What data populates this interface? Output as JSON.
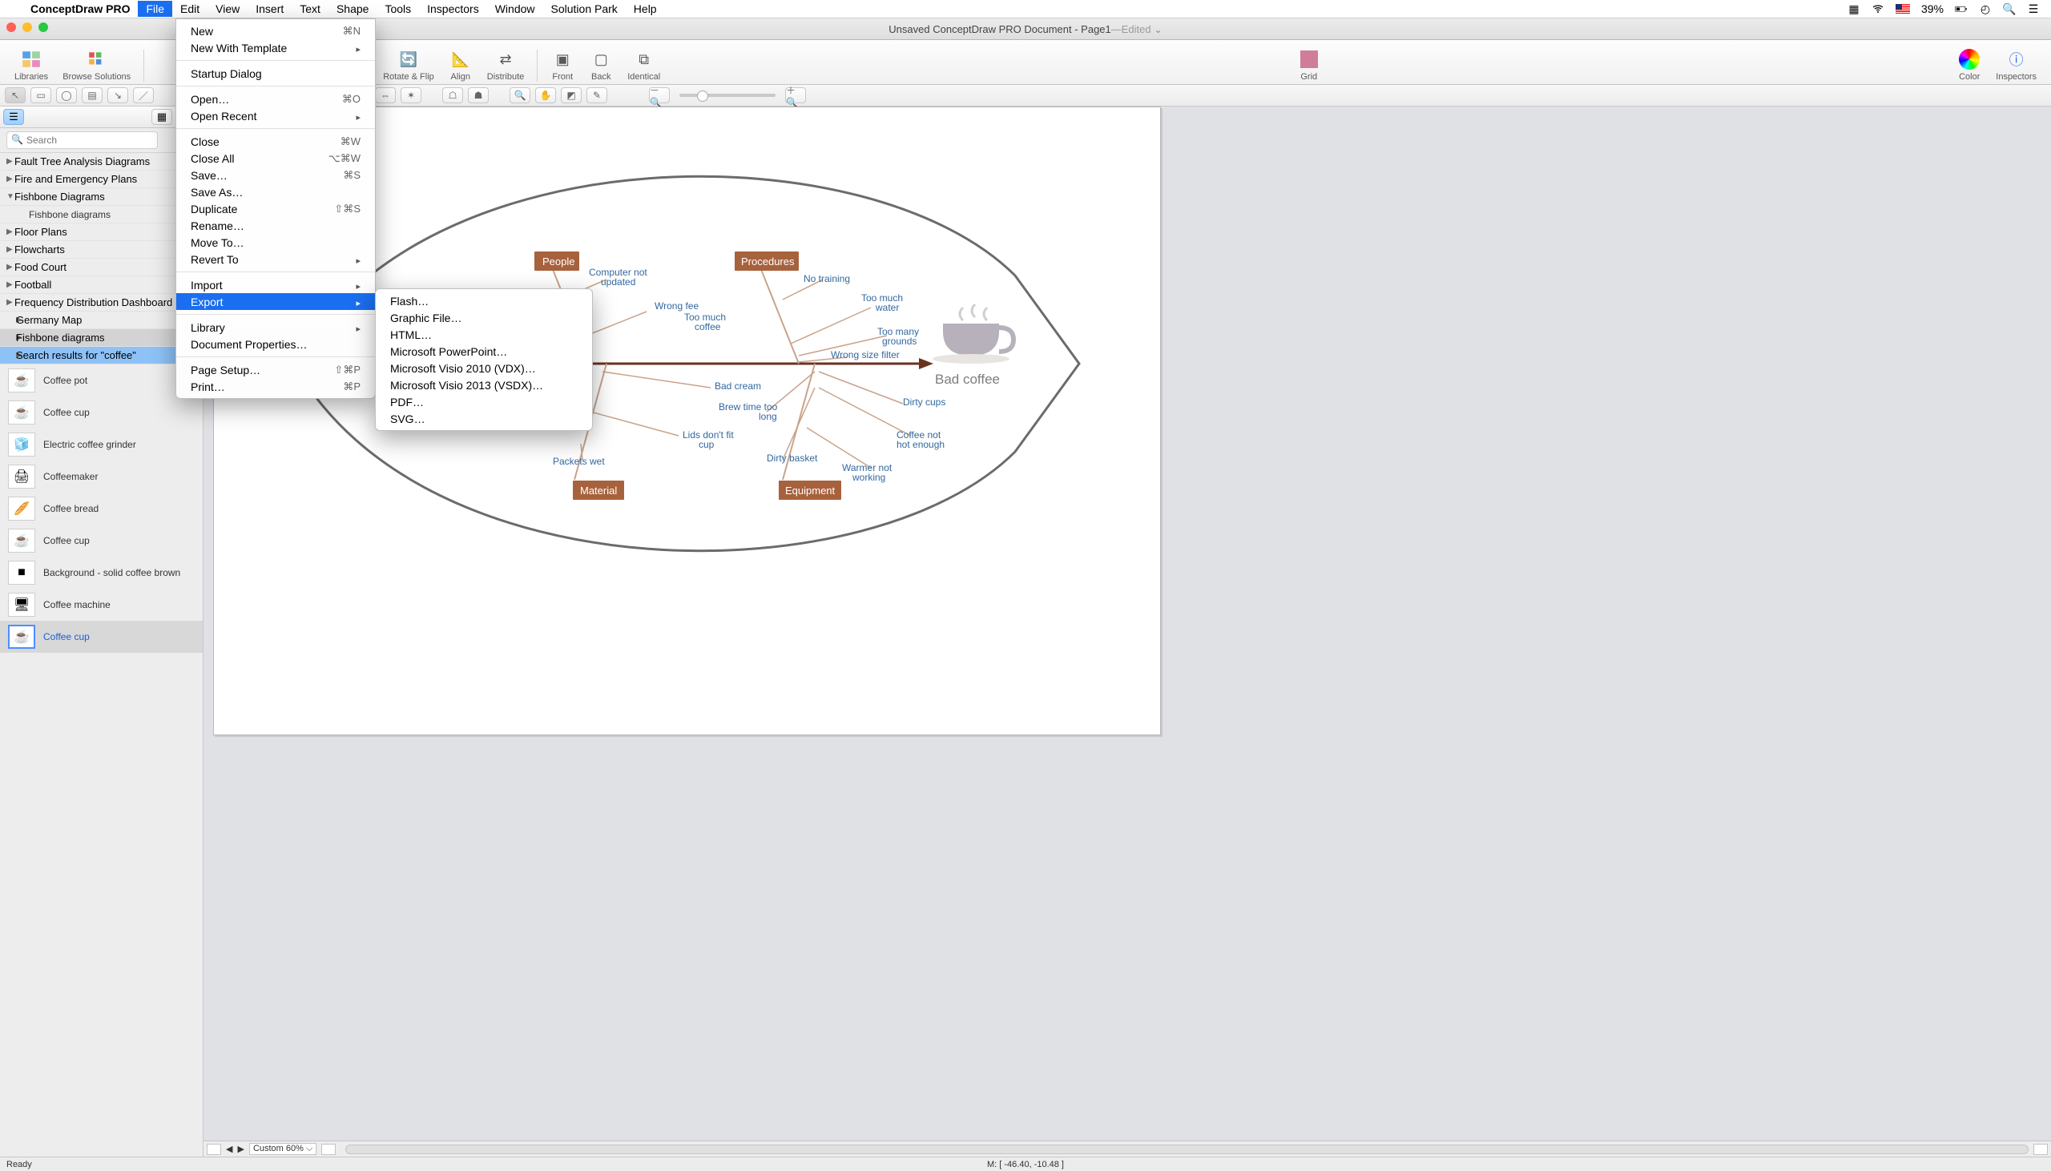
{
  "menubar": {
    "app_name": "ConceptDraw PRO",
    "items": [
      "File",
      "Edit",
      "View",
      "Insert",
      "Text",
      "Shape",
      "Tools",
      "Inspectors",
      "Window",
      "Solution Park",
      "Help"
    ],
    "active_index": 0
  },
  "mac_status": {
    "battery": "39%"
  },
  "window": {
    "title_main": "Unsaved ConceptDraw PRO Document - Page1",
    "title_sep": " — ",
    "title_state": "Edited"
  },
  "toolbar1": {
    "libraries": "Libraries",
    "browse": "Browse Solutions",
    "rotate": "Rotate & Flip",
    "align": "Align",
    "distribute": "Distribute",
    "front": "Front",
    "back": "Back",
    "identical": "Identical",
    "grid": "Grid",
    "color": "Color",
    "inspectors": "Inspectors"
  },
  "library_tree": {
    "items": [
      {
        "label": "Fault Tree Analysis Diagrams",
        "expanded": false
      },
      {
        "label": "Fire and Emergency Plans",
        "expanded": false
      },
      {
        "label": "Fishbone Diagrams",
        "expanded": true,
        "children": [
          "Fishbone diagrams"
        ]
      },
      {
        "label": "Floor Plans",
        "expanded": false
      },
      {
        "label": "Flowcharts",
        "expanded": false
      },
      {
        "label": "Food Court",
        "expanded": false
      },
      {
        "label": "Football",
        "expanded": false
      },
      {
        "label": "Frequency Distribution Dashboard",
        "expanded": false
      },
      {
        "label": "Germany Map",
        "expanded": false,
        "plain": true
      }
    ],
    "extra": [
      {
        "label": "Fishbone diagrams",
        "hi": true
      },
      {
        "label": "Search results for \"coffee\"",
        "sel": true
      }
    ]
  },
  "search_placeholder": "Search",
  "shapes": [
    {
      "name": "Coffee pot",
      "glyph": "☕"
    },
    {
      "name": "Coffee cup",
      "glyph": "☕"
    },
    {
      "name": "Electric coffee grinder",
      "glyph": "🧊"
    },
    {
      "name": "Coffeemaker",
      "glyph": "🖨"
    },
    {
      "name": "Coffee bread",
      "glyph": "🥖"
    },
    {
      "name": "Coffee cup",
      "glyph": "☕"
    },
    {
      "name": "Background - solid coffee brown",
      "glyph": "■"
    },
    {
      "name": "Coffee machine",
      "glyph": "🖥"
    },
    {
      "name": "Coffee cup",
      "glyph": "☕",
      "sel": true,
      "link": true
    }
  ],
  "file_menu": [
    {
      "label": "New",
      "shortcut": "⌘N"
    },
    {
      "label": "New With Template",
      "submenu": true
    },
    {
      "sep": true
    },
    {
      "label": "Startup Dialog"
    },
    {
      "sep": true
    },
    {
      "label": "Open…",
      "shortcut": "⌘O"
    },
    {
      "label": "Open Recent",
      "submenu": true
    },
    {
      "sep": true
    },
    {
      "label": "Close",
      "shortcut": "⌘W"
    },
    {
      "label": "Close All",
      "shortcut": "⌥⌘W"
    },
    {
      "label": "Save…",
      "shortcut": "⌘S"
    },
    {
      "label": "Save As…"
    },
    {
      "label": "Duplicate",
      "shortcut": "⇧⌘S"
    },
    {
      "label": "Rename…"
    },
    {
      "label": "Move To…"
    },
    {
      "label": "Revert To",
      "submenu": true
    },
    {
      "sep": true
    },
    {
      "label": "Import",
      "submenu": true
    },
    {
      "label": "Export",
      "submenu": true,
      "highlight": true
    },
    {
      "sep": true
    },
    {
      "label": "Library",
      "submenu": true
    },
    {
      "label": "Document Properties…"
    },
    {
      "sep": true
    },
    {
      "label": "Page Setup…",
      "shortcut": "⇧⌘P"
    },
    {
      "label": "Print…",
      "shortcut": "⌘P"
    }
  ],
  "export_submenu": [
    "Flash…",
    "Graphic File…",
    "HTML…",
    "Microsoft PowerPoint…",
    "Microsoft Visio 2010 (VDX)…",
    "Microsoft Visio 2013 (VSDX)…",
    "PDF…",
    "SVG…"
  ],
  "canvas_bottom": {
    "zoom_label": "Custom 60%"
  },
  "statusbar": {
    "ready": "Ready",
    "coords": "M: [ -46.40, -10.48 ]"
  },
  "fishbone": {
    "result": "Bad coffee",
    "categories": {
      "people": "People",
      "procedures": "Procedures",
      "material": "Material",
      "equipment": "Equipment"
    },
    "causes": {
      "computer": "Computer not\nupdated",
      "wrong_fee": "Wrong fee",
      "too_much_coffee": "Too much\ncoffee",
      "no_training": "No training",
      "too_much_water": "Too much\nwater",
      "too_many_grounds": "Too many\ngrounds",
      "wrong_filter": "Wrong size filter",
      "bad_cream": "Bad cream",
      "packets_wet": "Packets wet",
      "lids": "Lids don't fit\ncup",
      "brew_time": "Brew time too\nlong",
      "dirty_basket": "Dirty basket",
      "dirty_cups": "Dirty cups",
      "not_hot": "Coffee not\nhot enough",
      "warmer": "Warmer not\nworking"
    }
  }
}
